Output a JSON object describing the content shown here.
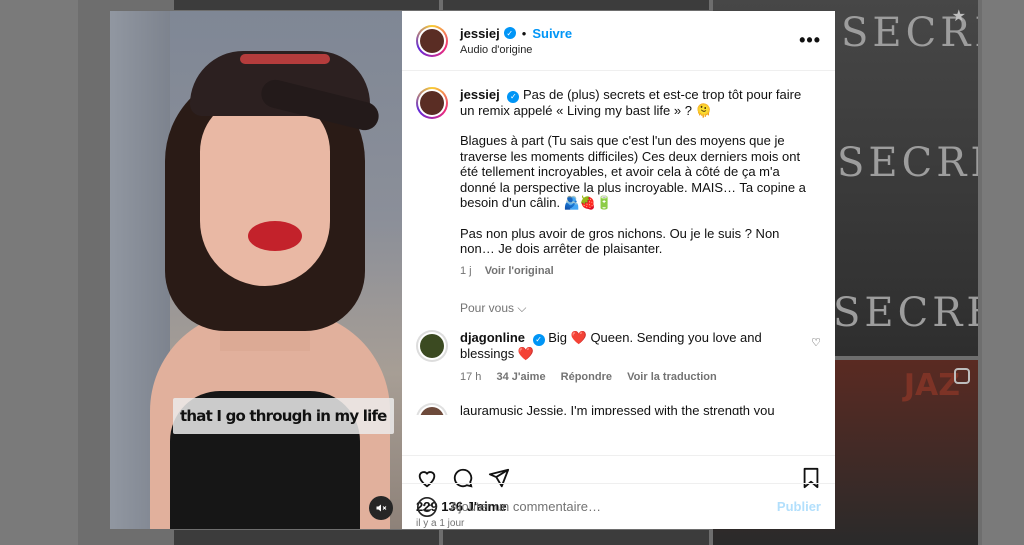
{
  "background": {
    "tile_texts": [
      "SECRET",
      "SECRET",
      "SECRET",
      "JAZ"
    ]
  },
  "post": {
    "username": "jessiej",
    "follow_label": "Suivre",
    "dot": "•",
    "audio_label": "Audio d'origine",
    "more_icon": "more-options-icon",
    "caption": {
      "username": "jessiej",
      "text_1": "Pas de (plus) secrets et est-ce trop tôt pour faire un remix appelé « Living my bast life » ? 🫠",
      "text_2": "Blagues à part (Tu sais que c'est l'un des moyens que je traverse les moments difficiles) Ces deux derniers mois ont été tellement incroyables, et avoir cela à côté de ça m'a donné la perspective la plus incroyable. MAIS… Ta copine a besoin d'un câlin. 🫂🍓🔋",
      "text_3": "Pas non plus avoir de gros nichons. Ou je le suis ? Non non… Je dois arrêter de plaisanter.",
      "age": "1 j",
      "see_original": "Voir l'original"
    },
    "for_you": "Pour vous",
    "comment": {
      "username": "djagonline",
      "text": "Big ❤️ Queen. Sending you love and blessings ❤️",
      "age": "17 h",
      "likes": "34 J'aime",
      "reply": "Répondre",
      "translate": "Voir la traduction"
    },
    "partial_comment": "lauramusic  Jessie, I'm impressed with the strength you",
    "likes_count": "229 136 J'aime",
    "posted_when": "il y a 1 jour",
    "add_comment_placeholder": "Ajouter un commentaire…",
    "publish_label": "Publier"
  },
  "video": {
    "subtitle": "that I go through in my life"
  }
}
